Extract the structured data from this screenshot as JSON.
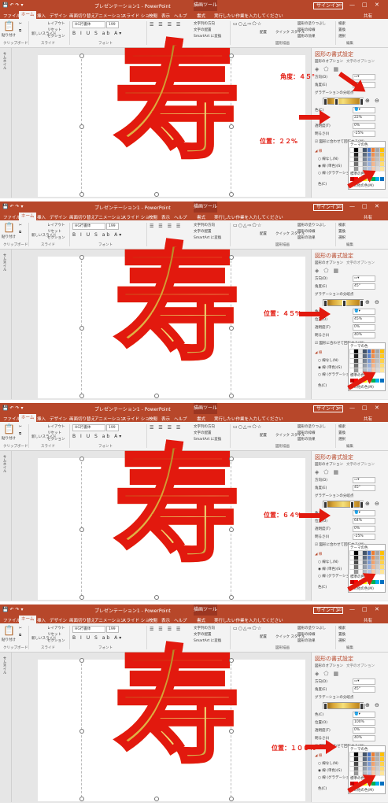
{
  "window": {
    "title": "プレゼンテーション1 - PowerPoint",
    "tool_context": "描画ツール",
    "signin": "サインイン",
    "share": "共有"
  },
  "tabs": [
    "ファイル",
    "ホーム",
    "挿入",
    "デザイン",
    "画面切り替え",
    "アニメーション",
    "スライド ショー",
    "校閲",
    "表示",
    "ヘルプ",
    "書式",
    "実行したい作業を入力してください"
  ],
  "ribbon": {
    "clipboard_label": "クリップボード",
    "paste": "貼り付け",
    "new_slide": "新しいスライド",
    "layout": "レイアウト",
    "reset": "リセット",
    "section": "セクション",
    "slides_label": "スライド",
    "font_name": "HG行書体",
    "font_size": "199",
    "font_label": "フォント",
    "paragraph_label": "段落",
    "text_direction": "文字列の方向",
    "align_text": "文字の配置",
    "smartart": "SmartArt に変換",
    "drawing_label": "図形描画",
    "arrange": "配置",
    "quick_styles": "クイック スタイル",
    "shape_fill": "図形の塗りつぶし",
    "shape_outline": "図形の枠線",
    "shape_effects": "図形の効果",
    "find": "検索",
    "replace": "置換",
    "select": "選択",
    "editing_label": "編集"
  },
  "sidebar_label": "サムネイル",
  "slide_text": "寿",
  "pane": {
    "title": "図形の書式設定",
    "tab_shape": "図形のオプション",
    "tab_text": "文字のオプション",
    "direction": "方向(D)",
    "angle": "角度(E)",
    "angle_value": "45°",
    "stops": "グラデーションの分岐点",
    "color": "色(C)",
    "position": "位置(O)",
    "transparency": "透明度(T)",
    "transparency_value": "0%",
    "brightness": "明るさ(I)",
    "rotate_with_shape": "図形に合わせて回転する(W)",
    "line_label": "線",
    "no_line": "線なし(N)",
    "solid_line": "線 (単色)(S)",
    "gradient_line": "線 (グラデーション)(G)",
    "theme_colors": "テーマの色",
    "standard_colors": "標準の色",
    "more_colors": "その他の色(M)",
    "eyedropper": "スポイト"
  },
  "panels": [
    {
      "position_value": "22%",
      "brightness_value": "-25%",
      "callout_position": "位置：２２%",
      "callout_angle": "角度：４５°"
    },
    {
      "position_value": "45%",
      "brightness_value": "40%",
      "callout_position": "位置：４５%",
      "callout_angle": ""
    },
    {
      "position_value": "64%",
      "brightness_value": "-25%",
      "callout_position": "位置：６４%",
      "callout_angle": ""
    },
    {
      "position_value": "100%",
      "brightness_value": "40%",
      "callout_position": "位置：１００%",
      "callout_angle": ""
    }
  ],
  "colors": {
    "accent": "#b7472a",
    "outline_red": "#e2190e",
    "gold_dark": "#7a4d0a",
    "gold_light": "#f5e07a"
  }
}
